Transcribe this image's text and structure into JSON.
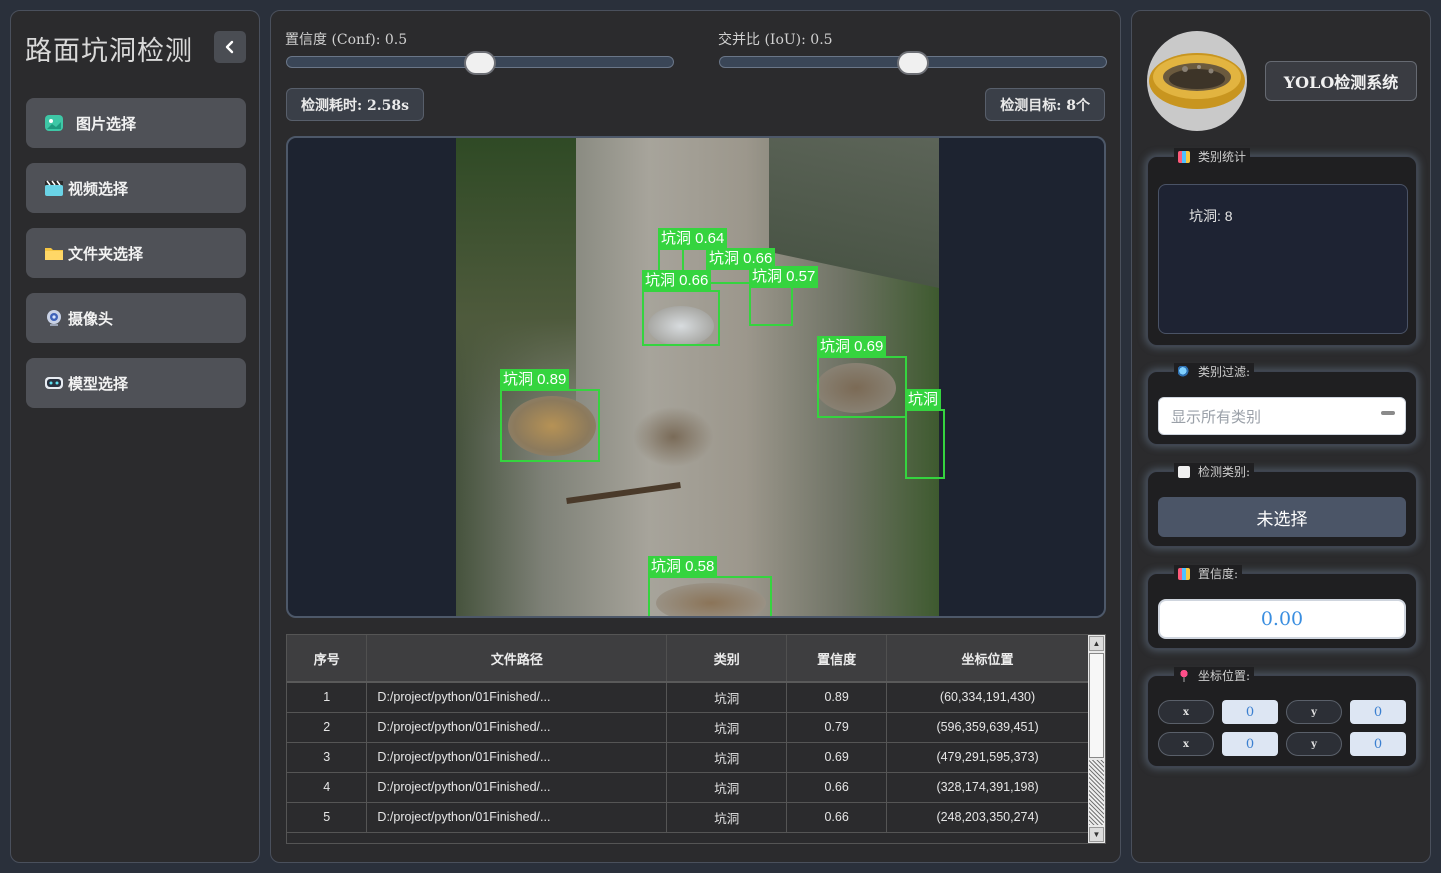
{
  "sidebar": {
    "title": "路面坑洞检测",
    "items": [
      {
        "label": "图片选择",
        "icon": "image-icon"
      },
      {
        "label": "视频选择",
        "icon": "clapperboard-icon"
      },
      {
        "label": "文件夹选择",
        "icon": "folder-icon"
      },
      {
        "label": "摄像头",
        "icon": "webcam-icon"
      },
      {
        "label": "模型选择",
        "icon": "robot-icon"
      }
    ]
  },
  "controls": {
    "conf_label": "置信度 (Conf): 0.5",
    "conf_value": 0.5,
    "iou_label": "交并比 (IoU): 0.5",
    "iou_value": 0.5,
    "time_label": "检测耗时: 2.58s",
    "targets_label": "检测目标: 8个"
  },
  "detections_overlay": [
    {
      "label": "坑洞 0.64"
    },
    {
      "label": "坑洞 0.66"
    },
    {
      "label": "坑洞 0.66"
    },
    {
      "label": "坑洞 0.57"
    },
    {
      "label": "坑洞 0.69"
    },
    {
      "label": "坑洞 0.89"
    },
    {
      "label": "坑洞"
    },
    {
      "label": "坑洞 0.58"
    }
  ],
  "table": {
    "headers": [
      "序号",
      "文件路径",
      "类别",
      "置信度",
      "坐标位置"
    ],
    "rows": [
      [
        "1",
        "D:/project/python/01Finished/...",
        "坑洞",
        "0.89",
        "(60,334,191,430)"
      ],
      [
        "2",
        "D:/project/python/01Finished/...",
        "坑洞",
        "0.79",
        "(596,359,639,451)"
      ],
      [
        "3",
        "D:/project/python/01Finished/...",
        "坑洞",
        "0.69",
        "(479,291,595,373)"
      ],
      [
        "4",
        "D:/project/python/01Finished/...",
        "坑洞",
        "0.66",
        "(328,174,391,198)"
      ],
      [
        "5",
        "D:/project/python/01Finished/...",
        "坑洞",
        "0.66",
        "(248,203,350,274)"
      ]
    ]
  },
  "right": {
    "system_title": "YOLO检测系统",
    "class_stats_title": "类别统计",
    "class_stats_text": "坑洞: 8",
    "filter_title": "类别过滤:",
    "filter_placeholder": "显示所有类别",
    "detect_class_title": "检测类别:",
    "detect_class_value": "未选择",
    "confidence_title": "置信度:",
    "confidence_value": "0.00",
    "coords_title": "坐标位置:",
    "coords": {
      "x1_label": "x",
      "x1_value": "0",
      "y1_label": "y",
      "y1_value": "0",
      "x2_label": "x",
      "x2_value": "0",
      "y2_label": "y",
      "y2_value": "0"
    }
  }
}
